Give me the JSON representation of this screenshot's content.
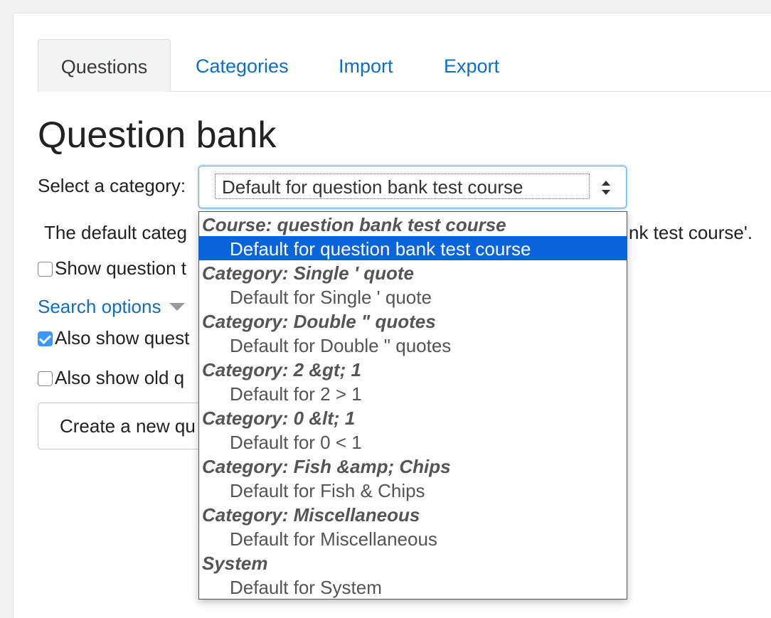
{
  "tabs": [
    {
      "label": "Questions",
      "active": true
    },
    {
      "label": "Categories",
      "active": false
    },
    {
      "label": "Import",
      "active": false
    },
    {
      "label": "Export",
      "active": false
    }
  ],
  "page": {
    "title": "Question bank",
    "select_label": "Select a category:",
    "selected_value": "Default for question bank test course",
    "description_left": "The default categ",
    "description_right": "nk test course'.",
    "show_question_text": {
      "label": "Show question t",
      "checked": false
    },
    "search_options": "Search options",
    "also_show_questions": {
      "label": "Also show quest",
      "checked": true
    },
    "also_show_old": {
      "label": "Also show old q",
      "checked": false
    },
    "create_button": "Create a new qu"
  },
  "dropdown": {
    "groups": [
      {
        "label": "Course: question bank test course",
        "options": [
          "Default for question bank test course"
        ]
      },
      {
        "label": "Category: Single ' quote",
        "options": [
          "Default for Single ' quote"
        ]
      },
      {
        "label": "Category: Double \" quotes",
        "options": [
          "Default for Double \" quotes"
        ]
      },
      {
        "label": "Category: 2 &gt; 1",
        "options": [
          "Default for 2 > 1"
        ]
      },
      {
        "label": "Category: 0 &lt; 1",
        "options": [
          "Default for 0 < 1"
        ]
      },
      {
        "label": "Category: Fish &amp; Chips",
        "options": [
          "Default for Fish & Chips"
        ]
      },
      {
        "label": "Category: Miscellaneous",
        "options": [
          "Default for Miscellaneous"
        ]
      },
      {
        "label": "System",
        "options": [
          "Default for System"
        ]
      }
    ],
    "selected": "Default for question bank test course"
  },
  "colors": {
    "link": "#0f6fc5",
    "selected_option_bg": "#0a64d9",
    "checkbox_checked": "#3b99fc",
    "focus_border": "#6aa3da"
  }
}
